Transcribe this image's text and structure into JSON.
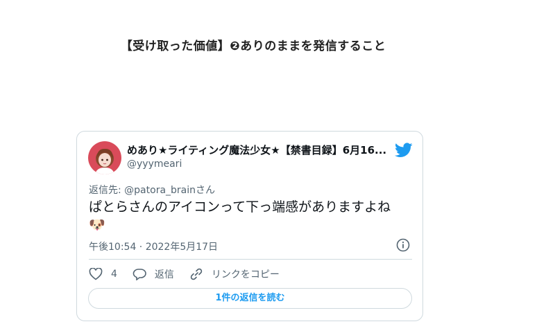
{
  "heading": "【受け取った価値】❷ありのままを発信すること",
  "tweet": {
    "author_name": "めあり★ライティング魔法少女★【禁書目録】6月16...",
    "handle": "@yyymeari",
    "replying_prefix": "返信先: ",
    "replying_to": "@patora_brainさん",
    "text": "ぱとらさんのアイコンって下っ端感がありますよね",
    "emoji": "🐶",
    "timestamp": "午後10:54 · 2022年5月17日",
    "likes": "4",
    "reply_label": "返信",
    "copy_link_label": "リンクをコピー",
    "read_replies_label": "1件の返信を読む"
  },
  "colors": {
    "twitter_blue": "#1d9bf0",
    "muted": "#536471",
    "border": "#cfd9de"
  }
}
